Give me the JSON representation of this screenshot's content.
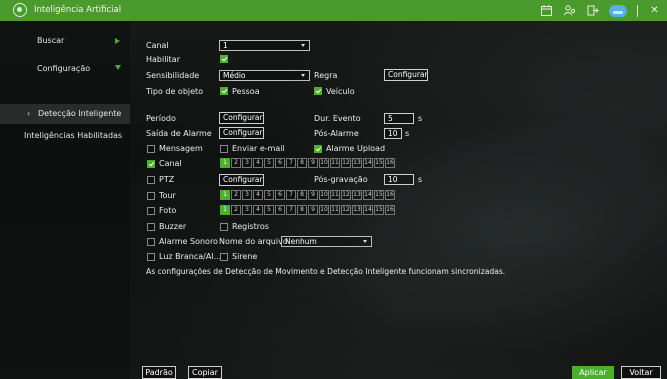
{
  "window": {
    "title": "Inteligência Artificial"
  },
  "sidebar": {
    "items": [
      {
        "label": "Buscar"
      },
      {
        "label": "Configuração"
      },
      {
        "label": "Detecção Inteligente"
      },
      {
        "label": "Inteligências Habilitadas"
      }
    ]
  },
  "form": {
    "canal_label": "Canal",
    "canal_value": "1",
    "habilitar_label": "Habilitar",
    "sensibilidade_label": "Sensibilidade",
    "sensibilidade_value": "Médio",
    "regra_label": "Regra",
    "configurar": "Configurar",
    "tipo_objeto_label": "Tipo de objeto",
    "pessoa": "Pessoa",
    "veiculo": "Veículo",
    "periodo_label": "Período",
    "dur_evento_label": "Dur. Evento",
    "dur_evento_value": "5",
    "seconds_unit": "s",
    "saida_alarme_label": "Saída de Alarme",
    "pos_alarme_label": "Pós-Alarme",
    "pos_alarme_value": "10",
    "mensagem": "Mensagem",
    "enviar_email": "Enviar e-mail",
    "alarme_upload": "Alarme Upload",
    "canal_cb": "Canal",
    "ptz": "PTZ",
    "pos_gravacao_label": "Pós-gravação",
    "pos_gravacao_value": "10",
    "tour": "Tour",
    "foto": "Foto",
    "buzzer": "Buzzer",
    "registros": "Registros",
    "alarme_sonoro": "Alarme Sonoro",
    "nome_arquivo_label": "Nome do arquivo",
    "nome_arquivo_value": "Nenhum",
    "luz_branca": "Luz Branca/Al...",
    "sirene": "Sirene",
    "note": "As configurações de Detecção de Movimento e Detecção Inteligente funcionam sincronizadas."
  },
  "channels": [
    "1",
    "2",
    "3",
    "4",
    "5",
    "6",
    "7",
    "8",
    "9",
    "10",
    "11",
    "12",
    "13",
    "14",
    "15",
    "16"
  ],
  "buttons": {
    "padrao": "Padrão",
    "copiar": "Copiar",
    "aplicar": "Aplicar",
    "voltar": "Voltar"
  },
  "colors": {
    "accent": "#4caf2c",
    "titlebar": "#4a9a2e"
  },
  "icons": [
    "app-logo-icon",
    "calendar-icon",
    "users-icon",
    "exit-icon",
    "cloud-icon",
    "close-icon"
  ]
}
